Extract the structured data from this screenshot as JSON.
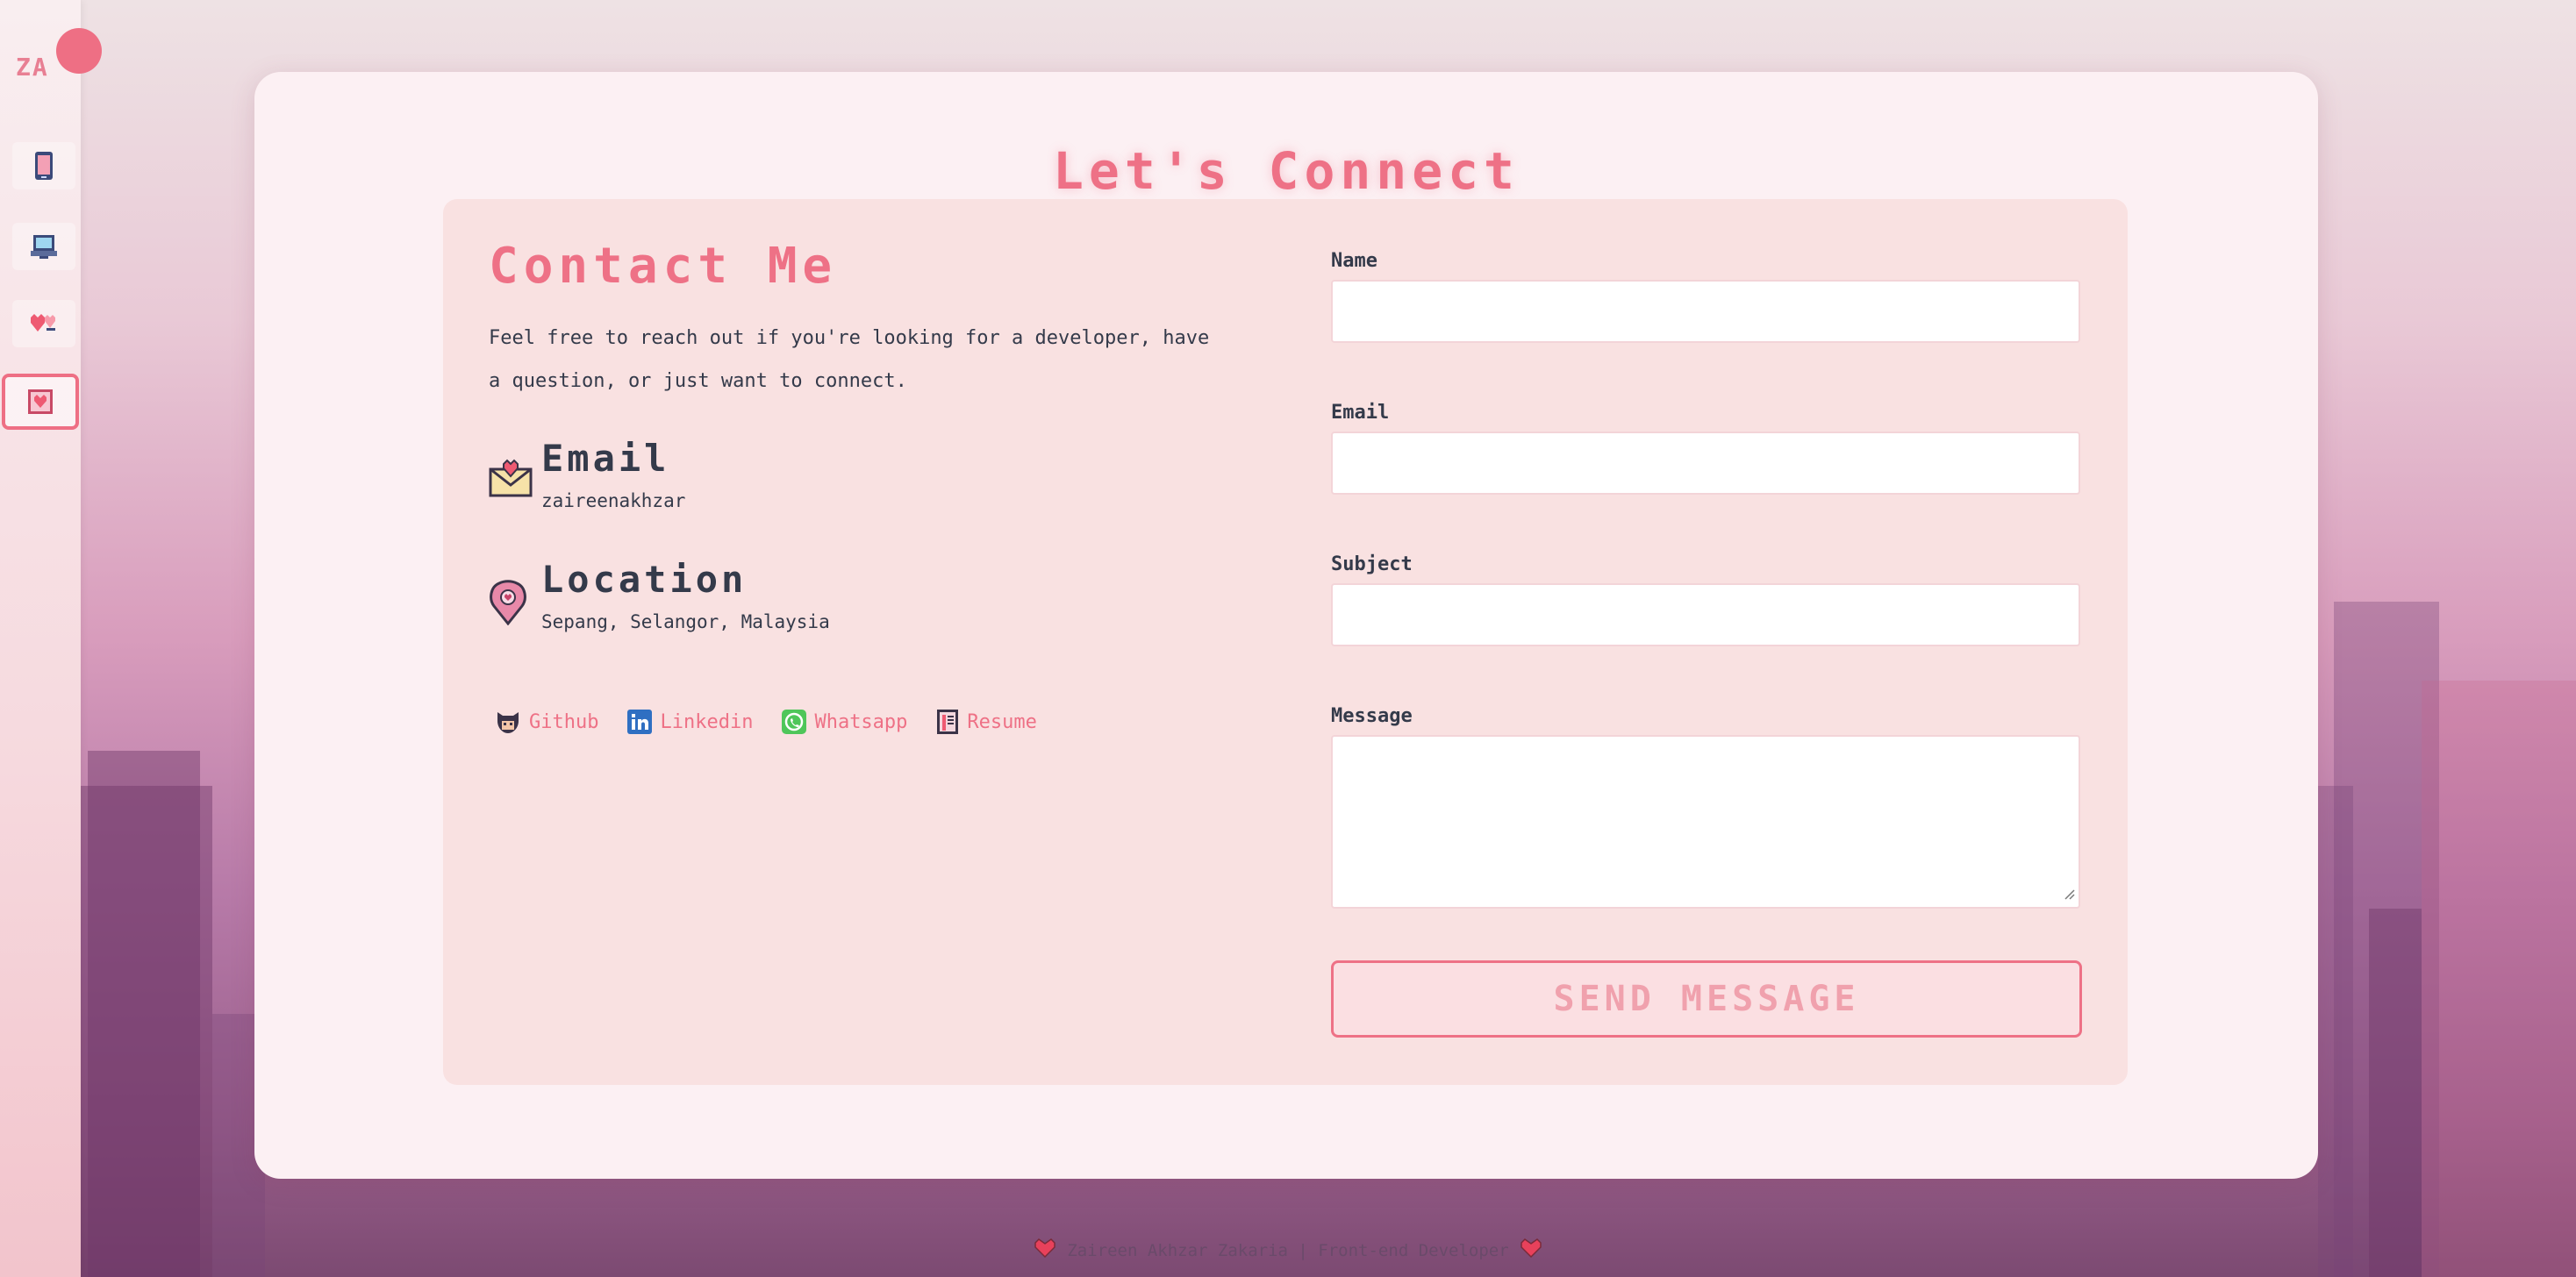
{
  "sidebar": {
    "logo": "ZA",
    "items": [
      {
        "icon": "phone-icon"
      },
      {
        "icon": "computer-icon"
      },
      {
        "icon": "hearts-icon"
      },
      {
        "icon": "heart-card-icon",
        "active": true
      }
    ]
  },
  "page": {
    "heading": "Let's Connect"
  },
  "contact": {
    "title": "Contact Me",
    "intro": "Feel free to reach out if you're looking for a developer, have a question, or just want to connect.",
    "email": {
      "title": "Email",
      "value": "zaireenakhzar",
      "icon": "envelope-heart-icon"
    },
    "location": {
      "title": "Location",
      "value": "Sepang, Selangor, Malaysia",
      "icon": "map-pin-icon"
    },
    "links": [
      {
        "label": "Github",
        "icon": "github-icon"
      },
      {
        "label": "Linkedin",
        "icon": "linkedin-icon"
      },
      {
        "label": "Whatsapp",
        "icon": "whatsapp-icon"
      },
      {
        "label": "Resume",
        "icon": "resume-icon"
      }
    ]
  },
  "form": {
    "name_label": "Name",
    "name_value": "",
    "email_label": "Email",
    "email_value": "",
    "subject_label": "Subject",
    "subject_value": "",
    "message_label": "Message",
    "message_value": "",
    "send_label": "SEND MESSAGE"
  },
  "footer": {
    "text": "Zaireen Akhzar Zakaria | Front-end Developer",
    "icon": "heart-icon"
  },
  "colors": {
    "accent": "#ee7186",
    "text": "#343a4a",
    "card": "#fcf0f3",
    "panel": "#f9e1e1"
  }
}
